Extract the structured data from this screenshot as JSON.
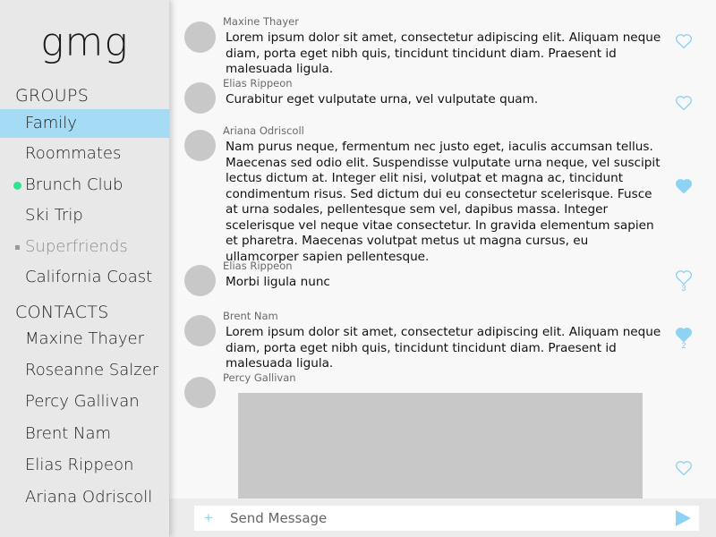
{
  "app": {
    "logo": "gmg"
  },
  "sidebar": {
    "groups_title": "GROUPS",
    "groups": [
      {
        "label": "Family",
        "state": "active"
      },
      {
        "label": "Roommates",
        "state": "normal"
      },
      {
        "label": "Brunch Club",
        "state": "online"
      },
      {
        "label": "Ski Trip",
        "state": "normal"
      },
      {
        "label": "Superfriends",
        "state": "muted"
      },
      {
        "label": "California Coast",
        "state": "normal"
      }
    ],
    "contacts_title": "CONTACTS",
    "contacts": [
      {
        "label": "Maxine Thayer"
      },
      {
        "label": "Roseanne Salzer"
      },
      {
        "label": "Percy Gallivan"
      },
      {
        "label": "Brent Nam"
      },
      {
        "label": "Elias Rippeon"
      },
      {
        "label": "Ariana Odriscoll"
      }
    ]
  },
  "messages": [
    {
      "sender": "Maxine Thayer",
      "text": "Lorem ipsum dolor sit amet, consectetur adipiscing elit. Aliquam neque diam, porta eget nibh quis, tincidunt tincidunt diam. Praesent id malesuada ligula.",
      "liked": false,
      "likes": ""
    },
    {
      "sender": "Elias Rippeon",
      "text": "Curabitur eget vulputate urna, vel vulputate quam.",
      "liked": false,
      "likes": ""
    },
    {
      "sender": "Ariana Odriscoll",
      "text": "Nam purus neque, fermentum nec justo eget, iaculis accumsan tellus. Maecenas sed odio elit. Suspendisse vulputate urna neque, vel suscipit lectus dictum at. Integer elit nisi, volutpat et magna ac, tincidunt condimentum risus. Sed dictum dui eu consectetur scelerisque. Fusce at urna sodales, pellentesque sem vel, dapibus massa. Integer scelerisque vel neque vitae consectetur. In gravida elementum sapien et pharetra. Maecenas volutpat metus ut magna cursus, eu ullamcorper sapien pellentesque.",
      "liked": true,
      "likes": ""
    },
    {
      "sender": "Elias Rippeon",
      "text": "Morbi ligula nunc",
      "liked": false,
      "likes": "3"
    },
    {
      "sender": "Brent Nam",
      "text": "Lorem ipsum dolor sit amet, consectetur adipiscing elit. Aliquam neque diam, porta eget nibh quis, tincidunt tincidunt diam. Praesent id malesuada ligula.",
      "liked": true,
      "likes": "2"
    },
    {
      "sender": "Percy Gallivan",
      "text": "",
      "liked": false,
      "likes": "",
      "attachment": "image"
    }
  ],
  "composer": {
    "placeholder": "Send Message",
    "plus_icon": "plus-icon",
    "send_icon": "send-arrow-icon"
  },
  "colors": {
    "accent": "#a6dbf5",
    "heart": "#8fd3f4",
    "online": "#2fe58f",
    "avatar": "#c8c8c8"
  }
}
